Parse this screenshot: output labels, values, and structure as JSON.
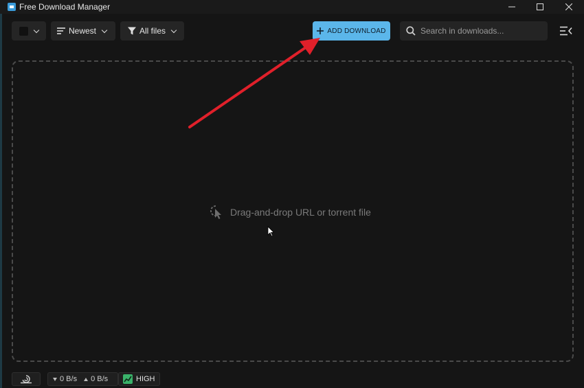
{
  "window": {
    "title": "Free Download Manager"
  },
  "toolbar": {
    "sort_label": "Newest",
    "filter_label": "All files",
    "add_download_label": "ADD DOWNLOAD",
    "search_placeholder": "Search in downloads..."
  },
  "drop_zone": {
    "hint": "Drag-and-drop URL or torrent file"
  },
  "statusbar": {
    "download_speed": "0 B/s",
    "upload_speed": "0 B/s",
    "traffic_mode": "HIGH"
  },
  "colors": {
    "accent": "#5bb6ea",
    "background": "#151515",
    "annotation_arrow": "#e0202a",
    "traffic_mode_badge": "#3ab26a"
  },
  "icons": [
    "app-logo-icon",
    "minimize-icon",
    "maximize-icon",
    "close-icon",
    "checkbox-icon",
    "chevron-down-icon",
    "sort-lines-icon",
    "filter-funnel-icon",
    "plus-icon",
    "search-icon",
    "menu-collapse-icon",
    "drag-drop-cursor-icon",
    "snail-icon",
    "arrow-down-icon",
    "arrow-up-icon",
    "trend-chart-icon"
  ]
}
